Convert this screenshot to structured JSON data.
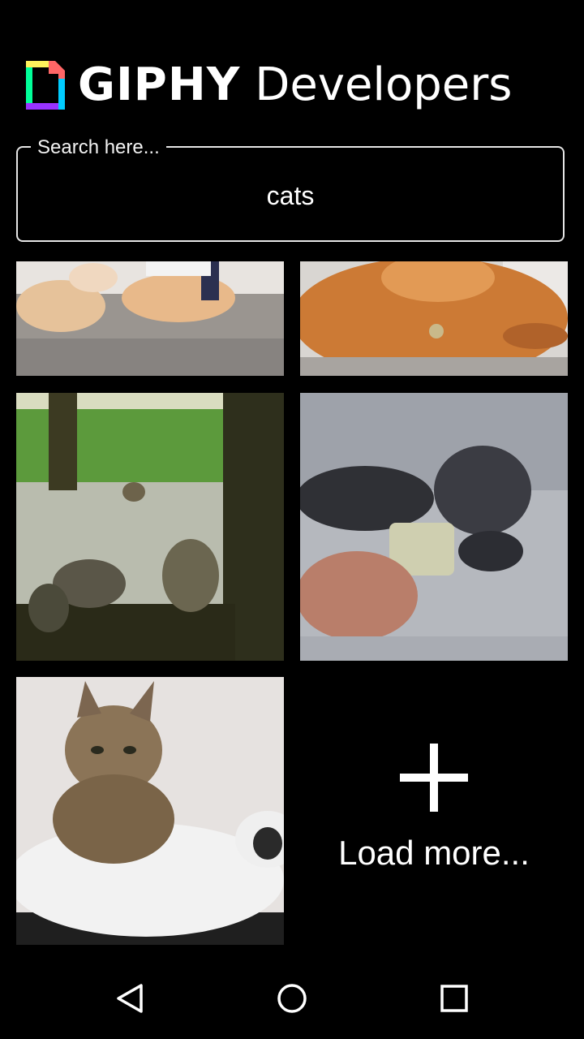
{
  "header": {
    "brand": "GIPHY",
    "product": "Developers"
  },
  "search": {
    "label": "Search here...",
    "value": "cats"
  },
  "grid": {
    "tiles": [
      {
        "icon": "cat-gif-thumbnail"
      },
      {
        "icon": "cat-gif-thumbnail"
      },
      {
        "icon": "cat-gif-thumbnail"
      },
      {
        "icon": "cat-gif-thumbnail"
      },
      {
        "icon": "cat-gif-thumbnail"
      }
    ],
    "load_more": {
      "icon": "plus-icon",
      "label": "Load more..."
    }
  },
  "navbar": {
    "back_icon": "back-triangle-icon",
    "home_icon": "home-circle-icon",
    "recents_icon": "recents-square-icon"
  },
  "colors": {
    "background": "#000000",
    "text": "#ffffff",
    "border": "#e6e6e6"
  }
}
